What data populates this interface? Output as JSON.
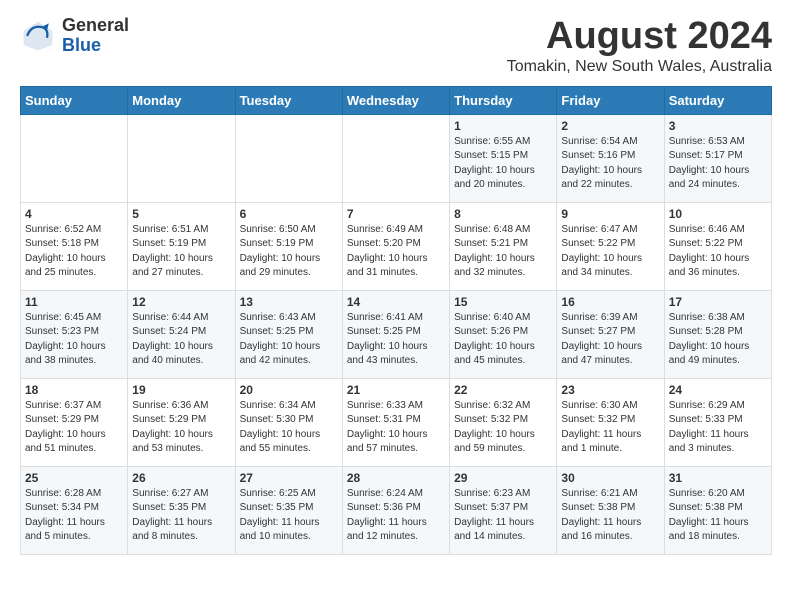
{
  "header": {
    "logo_general": "General",
    "logo_blue": "Blue",
    "month": "August 2024",
    "location": "Tomakin, New South Wales, Australia"
  },
  "weekdays": [
    "Sunday",
    "Monday",
    "Tuesday",
    "Wednesday",
    "Thursday",
    "Friday",
    "Saturday"
  ],
  "weeks": [
    [
      {
        "day": "",
        "info": ""
      },
      {
        "day": "",
        "info": ""
      },
      {
        "day": "",
        "info": ""
      },
      {
        "day": "",
        "info": ""
      },
      {
        "day": "1",
        "info": "Sunrise: 6:55 AM\nSunset: 5:15 PM\nDaylight: 10 hours\nand 20 minutes."
      },
      {
        "day": "2",
        "info": "Sunrise: 6:54 AM\nSunset: 5:16 PM\nDaylight: 10 hours\nand 22 minutes."
      },
      {
        "day": "3",
        "info": "Sunrise: 6:53 AM\nSunset: 5:17 PM\nDaylight: 10 hours\nand 24 minutes."
      }
    ],
    [
      {
        "day": "4",
        "info": "Sunrise: 6:52 AM\nSunset: 5:18 PM\nDaylight: 10 hours\nand 25 minutes."
      },
      {
        "day": "5",
        "info": "Sunrise: 6:51 AM\nSunset: 5:19 PM\nDaylight: 10 hours\nand 27 minutes."
      },
      {
        "day": "6",
        "info": "Sunrise: 6:50 AM\nSunset: 5:19 PM\nDaylight: 10 hours\nand 29 minutes."
      },
      {
        "day": "7",
        "info": "Sunrise: 6:49 AM\nSunset: 5:20 PM\nDaylight: 10 hours\nand 31 minutes."
      },
      {
        "day": "8",
        "info": "Sunrise: 6:48 AM\nSunset: 5:21 PM\nDaylight: 10 hours\nand 32 minutes."
      },
      {
        "day": "9",
        "info": "Sunrise: 6:47 AM\nSunset: 5:22 PM\nDaylight: 10 hours\nand 34 minutes."
      },
      {
        "day": "10",
        "info": "Sunrise: 6:46 AM\nSunset: 5:22 PM\nDaylight: 10 hours\nand 36 minutes."
      }
    ],
    [
      {
        "day": "11",
        "info": "Sunrise: 6:45 AM\nSunset: 5:23 PM\nDaylight: 10 hours\nand 38 minutes."
      },
      {
        "day": "12",
        "info": "Sunrise: 6:44 AM\nSunset: 5:24 PM\nDaylight: 10 hours\nand 40 minutes."
      },
      {
        "day": "13",
        "info": "Sunrise: 6:43 AM\nSunset: 5:25 PM\nDaylight: 10 hours\nand 42 minutes."
      },
      {
        "day": "14",
        "info": "Sunrise: 6:41 AM\nSunset: 5:25 PM\nDaylight: 10 hours\nand 43 minutes."
      },
      {
        "day": "15",
        "info": "Sunrise: 6:40 AM\nSunset: 5:26 PM\nDaylight: 10 hours\nand 45 minutes."
      },
      {
        "day": "16",
        "info": "Sunrise: 6:39 AM\nSunset: 5:27 PM\nDaylight: 10 hours\nand 47 minutes."
      },
      {
        "day": "17",
        "info": "Sunrise: 6:38 AM\nSunset: 5:28 PM\nDaylight: 10 hours\nand 49 minutes."
      }
    ],
    [
      {
        "day": "18",
        "info": "Sunrise: 6:37 AM\nSunset: 5:29 PM\nDaylight: 10 hours\nand 51 minutes."
      },
      {
        "day": "19",
        "info": "Sunrise: 6:36 AM\nSunset: 5:29 PM\nDaylight: 10 hours\nand 53 minutes."
      },
      {
        "day": "20",
        "info": "Sunrise: 6:34 AM\nSunset: 5:30 PM\nDaylight: 10 hours\nand 55 minutes."
      },
      {
        "day": "21",
        "info": "Sunrise: 6:33 AM\nSunset: 5:31 PM\nDaylight: 10 hours\nand 57 minutes."
      },
      {
        "day": "22",
        "info": "Sunrise: 6:32 AM\nSunset: 5:32 PM\nDaylight: 10 hours\nand 59 minutes."
      },
      {
        "day": "23",
        "info": "Sunrise: 6:30 AM\nSunset: 5:32 PM\nDaylight: 11 hours\nand 1 minute."
      },
      {
        "day": "24",
        "info": "Sunrise: 6:29 AM\nSunset: 5:33 PM\nDaylight: 11 hours\nand 3 minutes."
      }
    ],
    [
      {
        "day": "25",
        "info": "Sunrise: 6:28 AM\nSunset: 5:34 PM\nDaylight: 11 hours\nand 5 minutes."
      },
      {
        "day": "26",
        "info": "Sunrise: 6:27 AM\nSunset: 5:35 PM\nDaylight: 11 hours\nand 8 minutes."
      },
      {
        "day": "27",
        "info": "Sunrise: 6:25 AM\nSunset: 5:35 PM\nDaylight: 11 hours\nand 10 minutes."
      },
      {
        "day": "28",
        "info": "Sunrise: 6:24 AM\nSunset: 5:36 PM\nDaylight: 11 hours\nand 12 minutes."
      },
      {
        "day": "29",
        "info": "Sunrise: 6:23 AM\nSunset: 5:37 PM\nDaylight: 11 hours\nand 14 minutes."
      },
      {
        "day": "30",
        "info": "Sunrise: 6:21 AM\nSunset: 5:38 PM\nDaylight: 11 hours\nand 16 minutes."
      },
      {
        "day": "31",
        "info": "Sunrise: 6:20 AM\nSunset: 5:38 PM\nDaylight: 11 hours\nand 18 minutes."
      }
    ]
  ]
}
